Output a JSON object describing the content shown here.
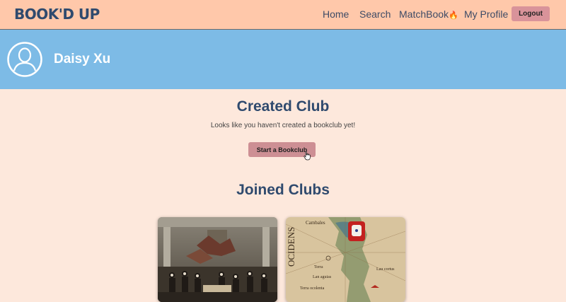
{
  "brand": {
    "name": "BOOK'D UP"
  },
  "nav": {
    "home": "Home",
    "search": "Search",
    "matchbook": "MatchBook",
    "matchbook_emoji": "🔥",
    "profile": "My Profile",
    "logout": "Logout"
  },
  "profile": {
    "name": "Daisy Xu"
  },
  "created": {
    "title": "Created Club",
    "message": "Looks like you haven't created a bookclub yet!",
    "start_button": "Start a Bookclub"
  },
  "joined": {
    "title": "Joined Clubs",
    "map_words": [
      "Cambales",
      "OCIDENS",
      "Terra",
      "Lau cortus",
      "Lan aguias",
      "Terra ocolenta"
    ]
  },
  "colors": {
    "navbar": "#ffc8aa",
    "profile_band": "#7dbbe6",
    "page_bg": "#fde8dc",
    "accent_button": "#d9939a",
    "title_text": "#2f4a6e"
  },
  "icons": {
    "avatar": "user-outline-icon",
    "cursor": "hand-pointer-icon"
  }
}
